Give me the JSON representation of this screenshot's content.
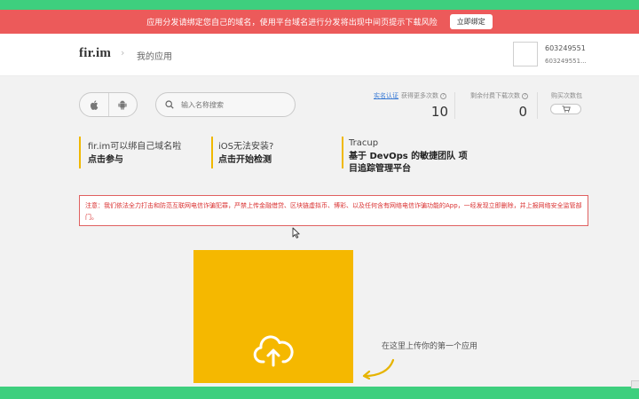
{
  "banner": {
    "text": "应用分发请绑定您自己的域名，使用平台域名进行分发将出现中间页提示下载风险",
    "button": "立即绑定"
  },
  "header": {
    "logo": "fir.im",
    "breadcrumb": "我的应用",
    "user_name": "603249551",
    "user_sub": "603249551..."
  },
  "search": {
    "placeholder": "输入名称搜索"
  },
  "stats": {
    "verify_link": "实名认证",
    "more_label": "获得更多次数",
    "more_value": "10",
    "remaining_label": "剩余付费下载次数",
    "remaining_value": "0",
    "buy_label": "购买次数包"
  },
  "promos": [
    {
      "sub": "fir.im可以绑自己域名啦",
      "title": "点击参与"
    },
    {
      "sub": "iOS无法安装?",
      "title": "点击开始检测"
    },
    {
      "sub": "Tracup",
      "title": "基于 DevOps 的敏捷团队 项目追踪管理平台"
    }
  ],
  "notice": "注意：我们依法全力打击和防范互联网电信诈骗犯罪，严禁上传金融借贷、区块链虚拟币、博彩、以及任何含有网络电信诈骗功能的App，一经发现立即删除，并上报网络安全监管部门。",
  "upload": {
    "hint": "在这里上传你的第一个应用"
  },
  "colors": {
    "accent_green": "#3ecf7e",
    "banner_red": "#ec5a5a",
    "upload_yellow": "#f5b800",
    "notice_red": "#d93030",
    "link_blue": "#3a7bd5"
  }
}
